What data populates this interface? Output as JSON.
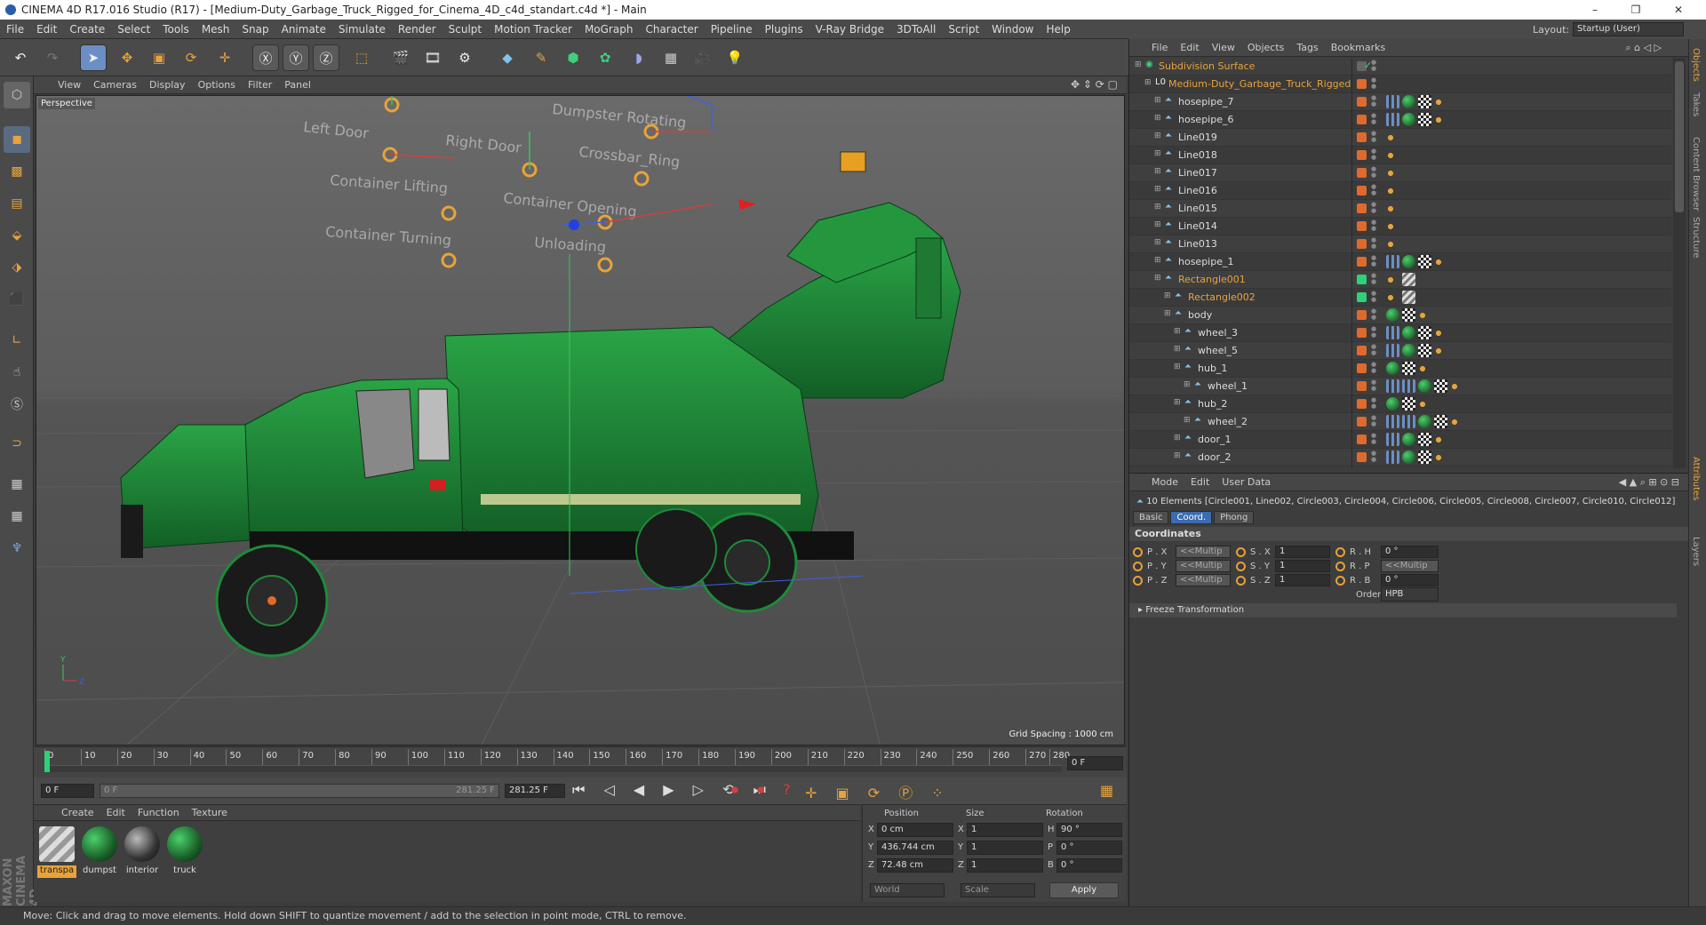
{
  "window": {
    "title": "CINEMA 4D R17.016 Studio (R17) - [Medium-Duty_Garbage_Truck_Rigged_for_Cinema_4D_c4d_standart.c4d *] - Main",
    "minimize": "–",
    "maximize": "❐",
    "close": "✕"
  },
  "menu": [
    "File",
    "Edit",
    "Create",
    "Select",
    "Tools",
    "Mesh",
    "Snap",
    "Animate",
    "Simulate",
    "Render",
    "Sculpt",
    "Motion Tracker",
    "MoGraph",
    "Character",
    "Pipeline",
    "Plugins",
    "V-Ray Bridge",
    "3DToAll",
    "Script",
    "Window",
    "Help"
  ],
  "layout": {
    "label": "Layout:",
    "value": "Startup (User)"
  },
  "viewport": {
    "menu": [
      "View",
      "Cameras",
      "Display",
      "Options",
      "Filter",
      "Panel"
    ],
    "label": "Perspective",
    "grid_spacing": "Grid Spacing : 1000 cm",
    "rig_labels": [
      "Left Door",
      "Right Door",
      "Dumpster Rotating",
      "Container Lifting",
      "Container Opening",
      "Container Turning",
      "Unloading",
      "Crossbar_Ring"
    ]
  },
  "timeline": {
    "ticks": [
      "0",
      "10",
      "20",
      "30",
      "40",
      "50",
      "60",
      "70",
      "80",
      "90",
      "100",
      "110",
      "120",
      "130",
      "140",
      "150",
      "160",
      "170",
      "180",
      "190",
      "200",
      "210",
      "220",
      "230",
      "240",
      "250",
      "260",
      "270",
      "280"
    ],
    "current_frame": "0 F",
    "start_field": "0 F",
    "slider_start": "0 F",
    "slider_end": "281.25 F",
    "end_field": "281.25 F"
  },
  "materials": {
    "menu": [
      "Create",
      "Edit",
      "Function",
      "Texture"
    ],
    "items": [
      {
        "name": "transpa",
        "selected": true
      },
      {
        "name": "dumpst",
        "selected": false
      },
      {
        "name": "interior",
        "selected": false
      },
      {
        "name": "truck",
        "selected": false
      }
    ]
  },
  "coords": {
    "headers": [
      "Position",
      "Size",
      "Rotation"
    ],
    "rows": [
      {
        "axis": "X",
        "pos": "0 cm",
        "size_axis": "X",
        "size": "1",
        "rot_axis": "H",
        "rot": "90 °"
      },
      {
        "axis": "Y",
        "pos": "436.744 cm",
        "size_axis": "Y",
        "size": "1",
        "rot_axis": "P",
        "rot": "0 °"
      },
      {
        "axis": "Z",
        "pos": "72.48 cm",
        "size_axis": "Z",
        "size": "1",
        "rot_axis": "B",
        "rot": "0 °"
      }
    ],
    "mode": "World",
    "scale": "Scale",
    "apply": "Apply"
  },
  "objects": {
    "menu": [
      "File",
      "Edit",
      "View",
      "Objects",
      "Tags",
      "Bookmarks"
    ],
    "rows": [
      {
        "name": "Subdivision Surface",
        "indent": 0,
        "color": "#e8a33a",
        "type": "sub",
        "dot": "#666"
      },
      {
        "name": "Medium-Duty_Garbage_Truck_Rigged",
        "indent": 1,
        "color": "#e8a33a",
        "type": "null",
        "dot": "#e06a2c"
      },
      {
        "name": "hosepipe_7",
        "indent": 2,
        "color": "#ddd",
        "type": "spline",
        "dot": "#e06a2c",
        "tags": "full"
      },
      {
        "name": "hosepipe_6",
        "indent": 2,
        "color": "#ddd",
        "type": "spline",
        "dot": "#e06a2c",
        "tags": "full"
      },
      {
        "name": "Line019",
        "indent": 2,
        "color": "#ddd",
        "type": "spline",
        "dot": "#e06a2c",
        "tags": "dot"
      },
      {
        "name": "Line018",
        "indent": 2,
        "color": "#ddd",
        "type": "spline",
        "dot": "#e06a2c",
        "tags": "dot"
      },
      {
        "name": "Line017",
        "indent": 2,
        "color": "#ddd",
        "type": "spline",
        "dot": "#e06a2c",
        "tags": "dot"
      },
      {
        "name": "Line016",
        "indent": 2,
        "color": "#ddd",
        "type": "spline",
        "dot": "#e06a2c",
        "tags": "dot"
      },
      {
        "name": "Line015",
        "indent": 2,
        "color": "#ddd",
        "type": "spline",
        "dot": "#e06a2c",
        "tags": "dot"
      },
      {
        "name": "Line014",
        "indent": 2,
        "color": "#ddd",
        "type": "spline",
        "dot": "#e06a2c",
        "tags": "dot"
      },
      {
        "name": "Line013",
        "indent": 2,
        "color": "#ddd",
        "type": "spline",
        "dot": "#e06a2c",
        "tags": "dot"
      },
      {
        "name": "hosepipe_1",
        "indent": 2,
        "color": "#ddd",
        "type": "spline",
        "dot": "#e06a2c",
        "tags": "full"
      },
      {
        "name": "Rectangle001",
        "indent": 2,
        "color": "#e8a33a",
        "type": "spline",
        "dot": "#2ed17a",
        "tags": "rect"
      },
      {
        "name": "Rectangle002",
        "indent": 3,
        "color": "#e8a33a",
        "type": "spline",
        "dot": "#2ed17a",
        "tags": "rect"
      },
      {
        "name": "body",
        "indent": 3,
        "color": "#ddd",
        "type": "poly",
        "dot": "#e06a2c",
        "tags": "mat"
      },
      {
        "name": "wheel_3",
        "indent": 4,
        "color": "#ddd",
        "type": "poly",
        "dot": "#e06a2c",
        "tags": "mat2"
      },
      {
        "name": "wheel_5",
        "indent": 4,
        "color": "#ddd",
        "type": "poly",
        "dot": "#e06a2c",
        "tags": "mat2"
      },
      {
        "name": "hub_1",
        "indent": 4,
        "color": "#ddd",
        "type": "poly",
        "dot": "#e06a2c",
        "tags": "mat"
      },
      {
        "name": "wheel_1",
        "indent": 5,
        "color": "#ddd",
        "type": "poly",
        "dot": "#e06a2c",
        "tags": "mat3"
      },
      {
        "name": "hub_2",
        "indent": 4,
        "color": "#ddd",
        "type": "poly",
        "dot": "#e06a2c",
        "tags": "mat"
      },
      {
        "name": "wheel_2",
        "indent": 5,
        "color": "#ddd",
        "type": "poly",
        "dot": "#e06a2c",
        "tags": "mat3"
      },
      {
        "name": "door_1",
        "indent": 4,
        "color": "#ddd",
        "type": "poly",
        "dot": "#e06a2c",
        "tags": "mat2"
      },
      {
        "name": "door_2",
        "indent": 4,
        "color": "#ddd",
        "type": "poly",
        "dot": "#e06a2c",
        "tags": "mat2"
      }
    ]
  },
  "attributes": {
    "menu": [
      "Mode",
      "Edit",
      "User Data"
    ],
    "selection": "10 Elements [Circle001, Line002, Circle003, Circle004, Circle006, Circle005, Circle008, Circle007, Circle010, Circle012]",
    "tabs": [
      "Basic",
      "Coord.",
      "Phong"
    ],
    "active_tab": "Coord.",
    "section": "Coordinates",
    "fields": [
      {
        "p_label": "P . X",
        "p_val": "<<Multip",
        "s_label": "S . X",
        "s_val": "1",
        "r_label": "R . H",
        "r_val": "0 °"
      },
      {
        "p_label": "P . Y",
        "p_val": "<<Multip",
        "s_label": "S . Y",
        "s_val": "1",
        "r_label": "R . P",
        "r_val": "<<Multip"
      },
      {
        "p_label": "P . Z",
        "p_val": "<<Multip",
        "s_label": "S . Z",
        "s_val": "1",
        "r_label": "R . B",
        "r_val": "0 °"
      }
    ],
    "order_label": "Order",
    "order_value": "HPB",
    "freeze": "Freeze Transformation"
  },
  "side_tabs": [
    "Objects",
    "Takes",
    "Content Browser",
    "Structure",
    "Attributes",
    "Layers"
  ],
  "status": "Move: Click and drag to move elements. Hold down SHIFT to quantize movement / add to the selection in point mode, CTRL to remove.",
  "brand": "MAXON CINEMA 4D",
  "colors": {
    "accent": "#e8a33a",
    "truck_green": "#1f8a3a",
    "selection_blue": "#3c6cb0"
  }
}
